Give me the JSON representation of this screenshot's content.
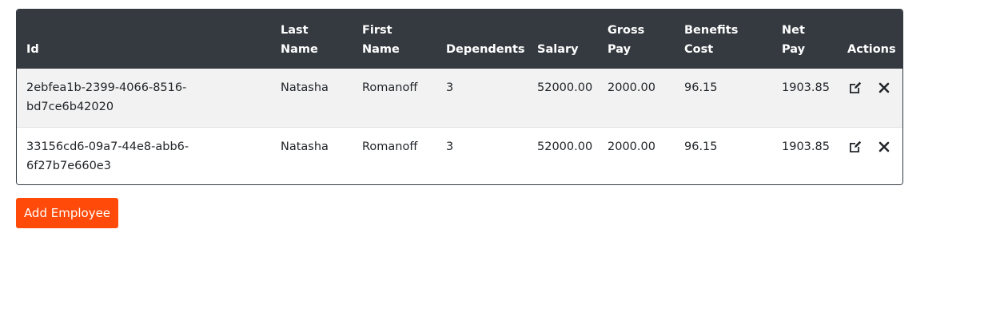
{
  "table": {
    "headers": {
      "id": "Id",
      "last_name": [
        "Last",
        "Name"
      ],
      "first_name": [
        "First",
        "Name"
      ],
      "dependents": "Dependents",
      "salary": "Salary",
      "gross_pay": [
        "Gross",
        "Pay"
      ],
      "benefits_cost": [
        "Benefits",
        "Cost"
      ],
      "net_pay": [
        "Net",
        "Pay"
      ],
      "actions": "Actions"
    },
    "rows": [
      {
        "id_line1": "2ebfea1b-2399-4066-8516-",
        "id_line2": "bd7ce6b42020",
        "last_name": "Natasha",
        "first_name": "Romanoff",
        "dependents": "3",
        "salary": "52000.00",
        "gross_pay": "2000.00",
        "benefits_cost": "96.15",
        "net_pay": "1903.85"
      },
      {
        "id_line1": "33156cd6-09a7-44e8-abb6-",
        "id_line2": "6f27b7e660e3",
        "last_name": "Natasha",
        "first_name": "Romanoff",
        "dependents": "3",
        "salary": "52000.00",
        "gross_pay": "2000.00",
        "benefits_cost": "96.15",
        "net_pay": "1903.85"
      }
    ],
    "row_actions": [
      "edit-icon",
      "close-icon"
    ]
  },
  "add_button": {
    "label": "Add Employee",
    "color": "#ff4a0a"
  },
  "colors": {
    "header_bg": "#343a40",
    "striped_row": "#f2f2f2"
  }
}
